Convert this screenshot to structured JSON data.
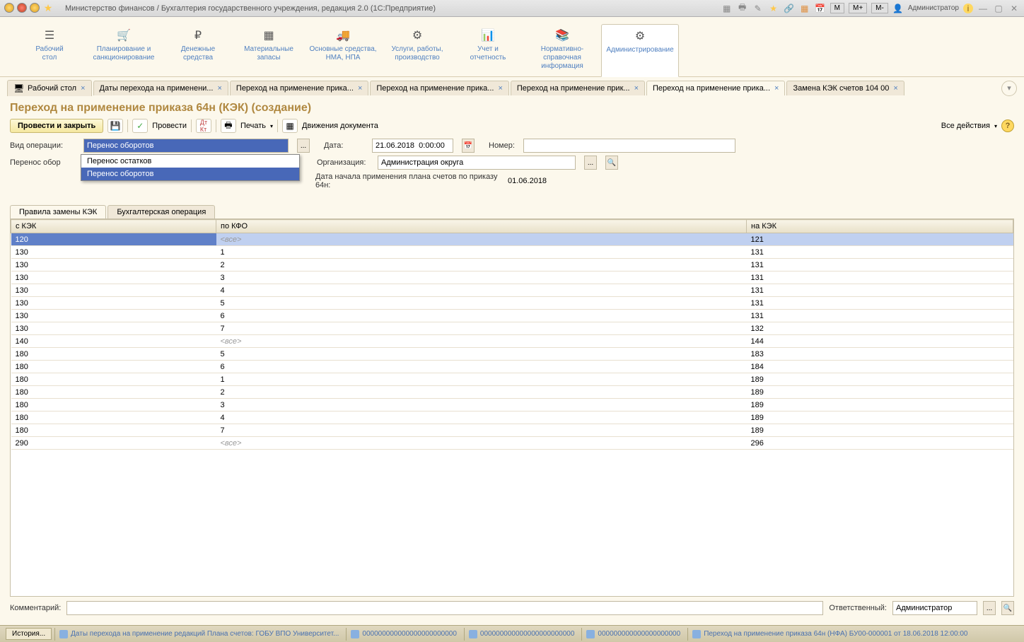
{
  "titlebar": {
    "title": "Министерство финансов / Бухгалтерия государственного учреждения, редакция 2.0  (1С:Предприятие)",
    "user": "Администратор",
    "m_buttons": [
      "M",
      "M+",
      "M-"
    ]
  },
  "sections": [
    {
      "label": "Рабочий\nстол"
    },
    {
      "label": "Планирование и\nсанкционирование"
    },
    {
      "label": "Денежные\nсредства"
    },
    {
      "label": "Материальные\nзапасы"
    },
    {
      "label": "Основные средства,\nНМА, НПА"
    },
    {
      "label": "Услуги, работы,\nпроизводство"
    },
    {
      "label": "Учет и\nотчетность"
    },
    {
      "label": "Нормативно-справочная\nинформация"
    },
    {
      "label": "Администрирование"
    }
  ],
  "doc_tabs": [
    {
      "label": "Рабочий стол"
    },
    {
      "label": "Даты перехода на применени..."
    },
    {
      "label": "Переход на применение прика..."
    },
    {
      "label": "Переход на применение прика..."
    },
    {
      "label": "Переход на применение прик..."
    },
    {
      "label": "Переход на применение прика..."
    },
    {
      "label": "Замена КЭК счетов 104 00"
    }
  ],
  "doc_title": "Переход на применение приказа 64н (КЭК) (создание)",
  "toolbar": {
    "save_close": "Провести и закрыть",
    "provesti": "Провести",
    "print": "Печать",
    "movements": "Движения документа",
    "all_actions": "Все действия"
  },
  "form": {
    "op_type_label": "Вид операции:",
    "op_type_value": "Перенос оборотов",
    "op_options": [
      "Перенос остатков",
      "Перенос оборотов"
    ],
    "transfer_label": "Перенос обор",
    "date_label": "Дата:",
    "date_value": "21.06.2018  0:00:00",
    "number_label": "Номер:",
    "number_value": "",
    "org_label": "Организация:",
    "org_value": "Администрация округа",
    "plan_label": "Дата начала применения плана счетов по приказу 64н:",
    "plan_value": "01.06.2018"
  },
  "subtabs": [
    "Правила замены КЭК",
    "Бухгалтерская операция"
  ],
  "table": {
    "headers": [
      "с КЭК",
      "по КФО",
      "на КЭК"
    ],
    "rows": [
      {
        "c": "120",
        "kfo": "<все>",
        "na": "121",
        "sel": true,
        "muted": true
      },
      {
        "c": "130",
        "kfo": "1",
        "na": "131"
      },
      {
        "c": "130",
        "kfo": "2",
        "na": "131"
      },
      {
        "c": "130",
        "kfo": "3",
        "na": "131"
      },
      {
        "c": "130",
        "kfo": "4",
        "na": "131"
      },
      {
        "c": "130",
        "kfo": "5",
        "na": "131"
      },
      {
        "c": "130",
        "kfo": "6",
        "na": "131"
      },
      {
        "c": "130",
        "kfo": "7",
        "na": "132"
      },
      {
        "c": "140",
        "kfo": "<все>",
        "na": "144",
        "muted": true
      },
      {
        "c": "180",
        "kfo": "5",
        "na": "183"
      },
      {
        "c": "180",
        "kfo": "6",
        "na": "184"
      },
      {
        "c": "180",
        "kfo": "1",
        "na": "189"
      },
      {
        "c": "180",
        "kfo": "2",
        "na": "189"
      },
      {
        "c": "180",
        "kfo": "3",
        "na": "189"
      },
      {
        "c": "180",
        "kfo": "4",
        "na": "189"
      },
      {
        "c": "180",
        "kfo": "7",
        "na": "189"
      },
      {
        "c": "290",
        "kfo": "<все>",
        "na": "296",
        "muted": true
      }
    ]
  },
  "bottom": {
    "comment_label": "Комментарий:",
    "responsible_label": "Ответственный:",
    "responsible_value": "Администратор"
  },
  "status": {
    "history": "История...",
    "items": [
      "Даты перехода на применение редакций Плана счетов: ГОБУ ВПО Университет...",
      "000000000000000000000000",
      "000000000000000000000000",
      "000000000000000000000",
      "Переход на применение приказа 64н (НФА) БУ00-000001 от 18.06.2018 12:00:00"
    ]
  }
}
